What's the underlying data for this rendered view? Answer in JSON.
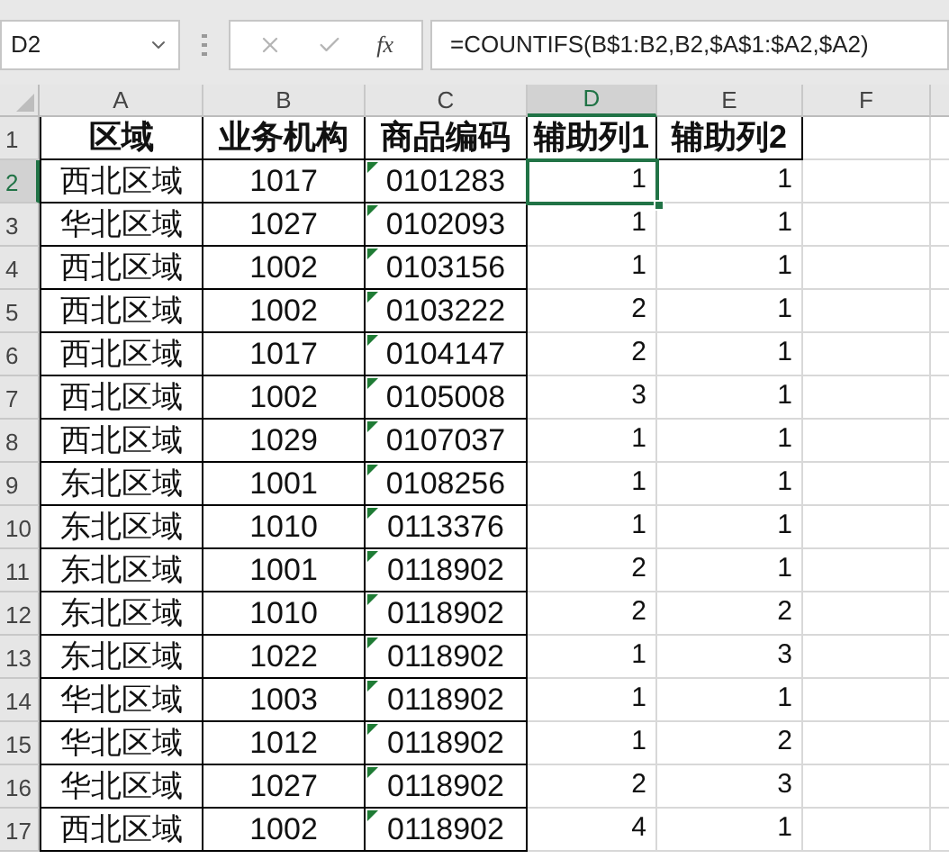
{
  "formula_bar": {
    "name_box": "D2",
    "function_label": "fx",
    "formula": "=COUNTIFS(B$1:B2,B2,$A$1:$A2,$A2)"
  },
  "columns": [
    {
      "label": "A",
      "selected": false
    },
    {
      "label": "B",
      "selected": false
    },
    {
      "label": "C",
      "selected": false
    },
    {
      "label": "D",
      "selected": true
    },
    {
      "label": "E",
      "selected": false
    },
    {
      "label": "F",
      "selected": false
    }
  ],
  "header_row": {
    "number": "1",
    "cells": [
      "区域",
      "业务机构",
      "商品编码",
      "辅助列1",
      "辅助列2"
    ]
  },
  "rows": [
    {
      "number": "2",
      "selected": true,
      "cells": [
        "西北区域",
        "1017",
        "0101283",
        "1",
        "1"
      ],
      "text_number_marker": true
    },
    {
      "number": "3",
      "selected": false,
      "cells": [
        "华北区域",
        "1027",
        "0102093",
        "1",
        "1"
      ],
      "text_number_marker": true
    },
    {
      "number": "4",
      "selected": false,
      "cells": [
        "西北区域",
        "1002",
        "0103156",
        "1",
        "1"
      ],
      "text_number_marker": true
    },
    {
      "number": "5",
      "selected": false,
      "cells": [
        "西北区域",
        "1002",
        "0103222",
        "2",
        "1"
      ],
      "text_number_marker": true
    },
    {
      "number": "6",
      "selected": false,
      "cells": [
        "西北区域",
        "1017",
        "0104147",
        "2",
        "1"
      ],
      "text_number_marker": true
    },
    {
      "number": "7",
      "selected": false,
      "cells": [
        "西北区域",
        "1002",
        "0105008",
        "3",
        "1"
      ],
      "text_number_marker": true
    },
    {
      "number": "8",
      "selected": false,
      "cells": [
        "西北区域",
        "1029",
        "0107037",
        "1",
        "1"
      ],
      "text_number_marker": true
    },
    {
      "number": "9",
      "selected": false,
      "cells": [
        "东北区域",
        "1001",
        "0108256",
        "1",
        "1"
      ],
      "text_number_marker": true
    },
    {
      "number": "10",
      "selected": false,
      "cells": [
        "东北区域",
        "1010",
        "0113376",
        "1",
        "1"
      ],
      "text_number_marker": true
    },
    {
      "number": "11",
      "selected": false,
      "cells": [
        "东北区域",
        "1001",
        "0118902",
        "2",
        "1"
      ],
      "text_number_marker": true
    },
    {
      "number": "12",
      "selected": false,
      "cells": [
        "东北区域",
        "1010",
        "0118902",
        "2",
        "2"
      ],
      "text_number_marker": true
    },
    {
      "number": "13",
      "selected": false,
      "cells": [
        "东北区域",
        "1022",
        "0118902",
        "1",
        "3"
      ],
      "text_number_marker": true
    },
    {
      "number": "14",
      "selected": false,
      "cells": [
        "华北区域",
        "1003",
        "0118902",
        "1",
        "1"
      ],
      "text_number_marker": true
    },
    {
      "number": "15",
      "selected": false,
      "cells": [
        "华北区域",
        "1012",
        "0118902",
        "1",
        "2"
      ],
      "text_number_marker": true
    },
    {
      "number": "16",
      "selected": false,
      "cells": [
        "华北区域",
        "1027",
        "0118902",
        "2",
        "3"
      ],
      "text_number_marker": true
    },
    {
      "number": "17",
      "selected": false,
      "cells": [
        "西北区域",
        "1002",
        "0118902",
        "4",
        "1"
      ],
      "text_number_marker": true
    }
  ]
}
